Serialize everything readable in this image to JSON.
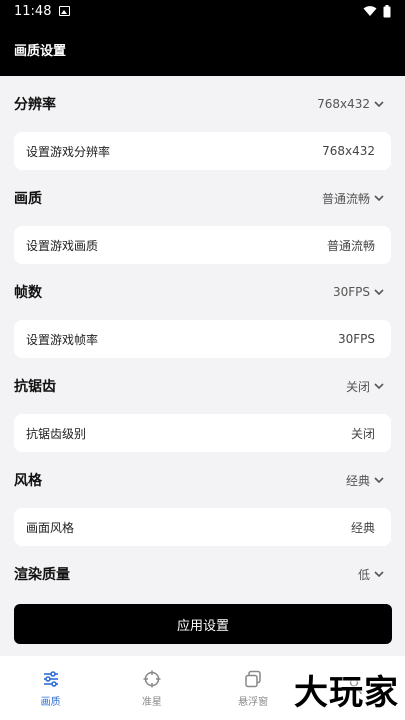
{
  "status": {
    "time": "11:48"
  },
  "app_bar": {
    "title": "画质设置"
  },
  "sections": [
    {
      "title": "分辨率",
      "value": "768x432",
      "card_label": "设置游戏分辨率",
      "card_value": "768x432"
    },
    {
      "title": "画质",
      "value": "普通流畅",
      "card_label": "设置游戏画质",
      "card_value": "普通流畅"
    },
    {
      "title": "帧数",
      "value": "30FPS",
      "card_label": "设置游戏帧率",
      "card_value": "30FPS"
    },
    {
      "title": "抗锯齿",
      "value": "关闭",
      "card_label": "抗锯齿级别",
      "card_value": "关闭"
    },
    {
      "title": "风格",
      "value": "经典",
      "card_label": "画面风格",
      "card_value": "经典"
    },
    {
      "title": "渲染质量",
      "value": "低"
    }
  ],
  "apply_button": {
    "label": "应用设置"
  },
  "bottom_nav": [
    {
      "label": "画质",
      "icon": "sliders-icon",
      "active": true
    },
    {
      "label": "准星",
      "icon": "crosshair-icon"
    },
    {
      "label": "悬浮窗",
      "icon": "floating-window-icon"
    },
    {
      "label": "",
      "icon": "profile-icon"
    }
  ],
  "watermark": {
    "text": "大玩家"
  },
  "colors": {
    "accent": "#2f6fd6",
    "bar": "#000000",
    "background": "#f3f3f5"
  }
}
